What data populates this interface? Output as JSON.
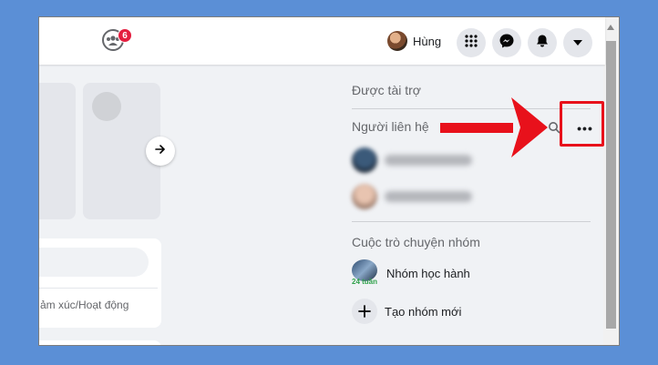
{
  "topbar": {
    "notification_count": "6",
    "profile_name": "Hùng",
    "buttons": [
      "menu-grid-icon",
      "messenger-icon",
      "bell-icon",
      "caret-down-icon"
    ]
  },
  "feed": {
    "post_action_text": "ảm xúc/Hoạt động"
  },
  "sidebar": {
    "sponsored_title": "Được tài trợ",
    "contacts_title": "Người liên hệ",
    "group_chats_title": "Cuộc trò chuyện nhóm",
    "group_chat": {
      "name": "Nhóm học hành",
      "time": "24 tuần"
    },
    "new_group_label": "Tạo nhóm mới",
    "more_button": "•••"
  },
  "annotation": {
    "arrow_color": "#e8111b",
    "highlight_color": "#e8111b"
  },
  "colors": {
    "background": "#5b8fd6",
    "badge": "#e41e3f",
    "active_green": "#31a24c"
  }
}
